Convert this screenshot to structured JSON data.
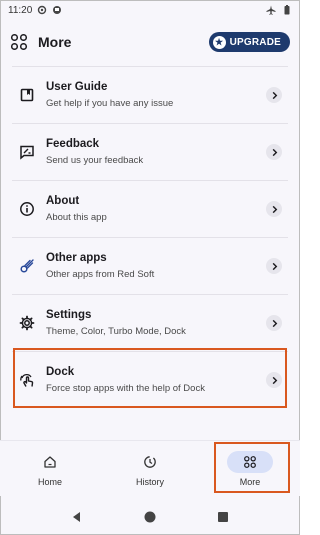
{
  "status_bar": {
    "time": "11:20"
  },
  "header": {
    "title": "More",
    "upgrade_label": "UPGRADE"
  },
  "items": [
    {
      "label": "User Guide",
      "sub": "Get help if you have any issue",
      "icon": "book-icon"
    },
    {
      "label": "Feedback",
      "sub": "Send us your feedback",
      "icon": "feedback-icon"
    },
    {
      "label": "About",
      "sub": "About this app",
      "icon": "info-icon"
    },
    {
      "label": "Other apps",
      "sub": "Other apps from Red Soft",
      "icon": "comet-icon"
    },
    {
      "label": "Settings",
      "sub": "Theme, Color, Turbo Mode, Dock",
      "icon": "gear-icon"
    },
    {
      "label": "Dock",
      "sub": "Force stop apps with the help of Dock",
      "icon": "touch-icon"
    }
  ],
  "bottom_nav": [
    {
      "label": "Home",
      "icon": "home-icon",
      "active": false
    },
    {
      "label": "History",
      "icon": "history-icon",
      "active": false
    },
    {
      "label": "More",
      "icon": "grid-icon",
      "active": true
    }
  ],
  "colors": {
    "accent": "#1e3a6d",
    "highlight": "#d9581f",
    "active_pill": "#d8e0f8"
  }
}
